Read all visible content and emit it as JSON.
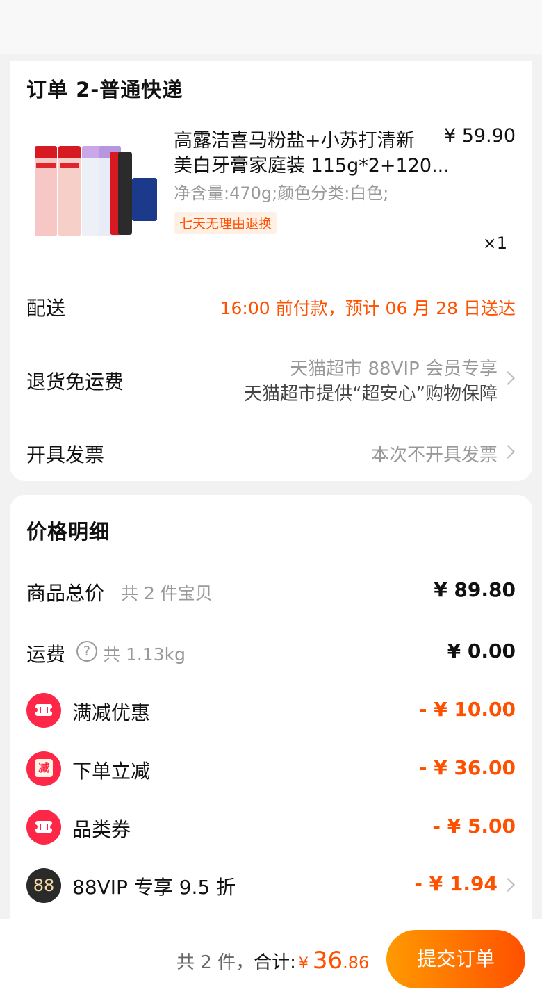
{
  "order": {
    "title": "订单 2-普通快递",
    "product": {
      "name_line1": "高露洁喜马粉盐+小苏打清新",
      "name_line2": "美白牙膏家庭装 115g*2+120...",
      "price": "¥ 59.90",
      "spec": "净含量:470g;颜色分类:白色;",
      "tag": "七天无理由退换",
      "quantity": "×1"
    },
    "delivery": {
      "label": "配送",
      "value": "16:00 前付款，预计 06 月 28 日送达"
    },
    "return_shipping": {
      "label": "退货免运费",
      "line1": "天猫超市 88VIP 会员专享",
      "line2": "天猫超市提供“超安心”购物保障"
    },
    "invoice": {
      "label": "开具发票",
      "value": "本次不开具发票"
    }
  },
  "price_detail": {
    "title": "价格明细",
    "goods_total": {
      "label": "商品总价",
      "sub": "共 2 件宝贝",
      "value": "¥ 89.80"
    },
    "shipping": {
      "label": "运费",
      "help_icon": "question-icon",
      "sub": "共 1.13kg",
      "value": "¥ 0.00"
    },
    "discounts": [
      {
        "label": "满减优惠",
        "value": "- ¥ 10.00",
        "icon": "ticket-icon"
      },
      {
        "label": "下单立减",
        "value": "- ¥ 36.00",
        "icon": "reduce-icon",
        "icon_text": "减"
      },
      {
        "label": "品类券",
        "value": "- ¥ 5.00",
        "icon": "ticket-icon"
      },
      {
        "label": "88VIP 专享 9.5 折",
        "value": "- ¥ 1.94",
        "icon": "vip-88-icon",
        "icon_text": "88"
      }
    ]
  },
  "footer": {
    "count_text": "共 2 件，",
    "total_label": "合计:",
    "currency": "¥",
    "total_int": "36",
    "total_dec": ".86",
    "submit_label": "提交订单"
  },
  "colors": {
    "accent": "#ff5000",
    "coupon_red": "#ff2748",
    "text_grey": "#999999"
  }
}
